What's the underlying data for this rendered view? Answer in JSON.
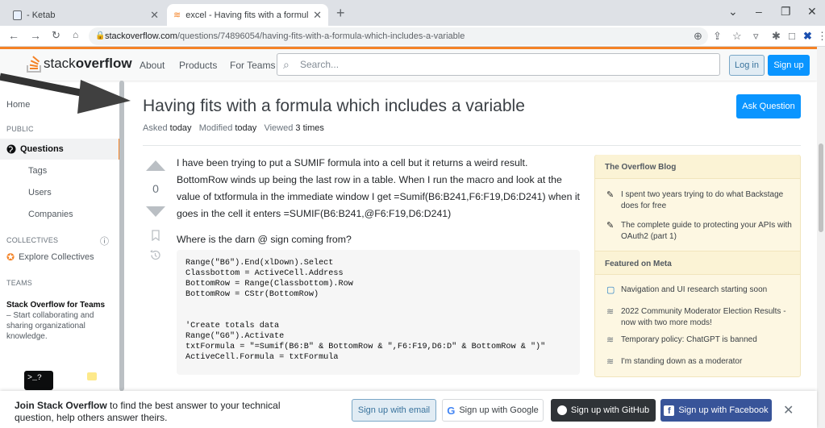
{
  "browser": {
    "tabs": [
      {
        "title": "- Ketab"
      },
      {
        "title": "excel - Having fits with a formula"
      }
    ],
    "url_host": "stackoverflow.com",
    "url_path": "/questions/74896054/having-fits-with-a-formula-which-includes-a-variable"
  },
  "so_header": {
    "logo_regular": "stack",
    "logo_bold": "overflow",
    "nav": [
      "About",
      "Products",
      "For Teams"
    ],
    "search_placeholder": "Search...",
    "login": "Log in",
    "signup": "Sign up"
  },
  "left_nav": {
    "home": "Home",
    "public": "PUBLIC",
    "questions": "Questions",
    "tags": "Tags",
    "users": "Users",
    "companies": "Companies",
    "collectives": "COLLECTIVES",
    "explore_collectives": "Explore Collectives",
    "teams": "TEAMS",
    "teams_title": "Stack Overflow for Teams",
    "teams_desc": " – Start collaborating and sharing organizational knowledge."
  },
  "question": {
    "title": "Having fits with a formula which includes a variable",
    "asked_label": "Asked",
    "asked": "today",
    "modified_label": "Modified",
    "modified": "today",
    "viewed_label": "Viewed",
    "viewed": "3 times",
    "ask_button": "Ask Question",
    "votes": "0",
    "para1": "I have been trying to put a SUMIF formula into a cell but it returns a weird result. BottomRow winds up being the last row in a table. When I run the macro and look at the value of txtformula in the immediate window I get =Sumif(B6:B241,F6:F19,D6:D241) when it goes in the cell it enters =SUMIF(B6:B241,@F6:F19,D6:D241)",
    "para2": "Where is the darn @ sign coming from?",
    "code": "Range(\"B6\").End(xlDown).Select\nClassbottom = ActiveCell.Address\nBottomRow = Range(Classbottom).Row\nBottomRow = CStr(BottomRow)\n\n\n'Create totals data\nRange(\"G6\").Activate\ntxtFormula = \"=Sumif(B6:B\" & BottomRow & \",F6:F19,D6:D\" & BottomRow & \")\"\nActiveCell.Formula = txtFormula"
  },
  "blog": {
    "header1": "The Overflow Blog",
    "items1": [
      "I spent two years trying to do what Backstage does for free",
      "The complete guide to protecting your APIs with OAuth2 (part 1)"
    ],
    "header2": "Featured on Meta",
    "items2": [
      "Navigation and UI research starting soon",
      "2022 Community Moderator Election Results - now with two more mods!",
      "Temporary policy: ChatGPT is banned",
      "I'm standing down as a moderator"
    ]
  },
  "join_bar": {
    "bold": "Join Stack Overflow",
    "text": " to find the best answer to your technical question, help others answer theirs.",
    "email": "Sign up with email",
    "google": "Sign up with Google",
    "github": "Sign up with GitHub",
    "facebook": "Sign up with Facebook"
  },
  "colors": {
    "accent": "#f48225",
    "primary": "#0a95ff"
  }
}
